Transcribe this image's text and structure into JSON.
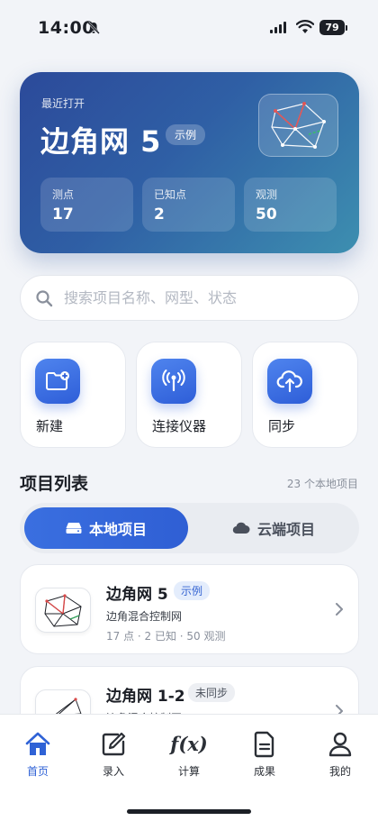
{
  "status_bar": {
    "time": "14:00",
    "battery": "79"
  },
  "hero": {
    "recent_label": "最近打开",
    "title": "边角网 5",
    "badge": "示例",
    "stats": [
      {
        "label": "测点",
        "value": "17"
      },
      {
        "label": "已知点",
        "value": "2"
      },
      {
        "label": "观测",
        "value": "50"
      }
    ]
  },
  "search": {
    "placeholder": "搜索项目名称、网型、状态"
  },
  "actions": [
    {
      "label": "新建",
      "icon": "new-folder-icon"
    },
    {
      "label": "连接仪器",
      "icon": "antenna-icon"
    },
    {
      "label": "同步",
      "icon": "cloud-upload-icon"
    }
  ],
  "projects_section": {
    "title": "项目列表",
    "count": "23 个本地项目"
  },
  "segment": {
    "local_label": "本地项目",
    "cloud_label": "云端项目"
  },
  "projects": [
    {
      "name": "边角网 5",
      "badge": "示例",
      "subtitle": "边角混合控制网",
      "meta": "17 点 · 2 已知 · 50 观测"
    },
    {
      "name": "边角网 1-2",
      "badge": "未同步",
      "subtitle": "边角混合控制网",
      "meta": ""
    }
  ],
  "tabbar": [
    {
      "label": "首页",
      "icon": "home-icon"
    },
    {
      "label": "录入",
      "icon": "edit-icon"
    },
    {
      "label": "计算",
      "icon": "fx-icon"
    },
    {
      "label": "成果",
      "icon": "document-icon"
    },
    {
      "label": "我的",
      "icon": "user-icon"
    }
  ],
  "colors": {
    "accent": "#2f62d6",
    "hero_start": "#2c4a9a",
    "hero_end": "#3d8fb0"
  }
}
